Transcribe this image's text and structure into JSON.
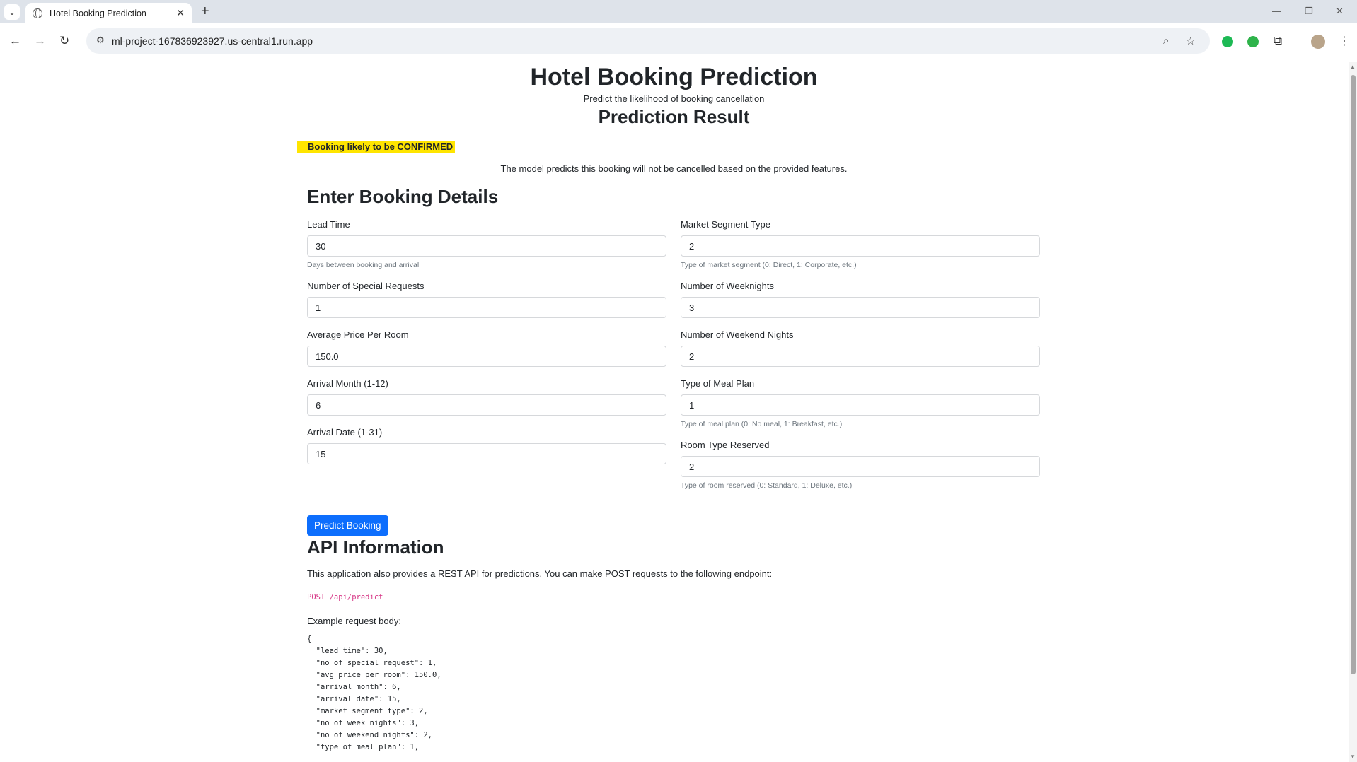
{
  "browser": {
    "tab_title": "Hotel Booking Prediction",
    "url": "ml-project-167836923927.us-central1.run.app"
  },
  "header": {
    "title": "Hotel Booking Prediction",
    "subtitle": "Predict the likelihood of booking cancellation"
  },
  "result": {
    "title": "Prediction Result",
    "badge": "Booking likely to be CONFIRMED",
    "description": "The model predicts this booking will not be cancelled based on the provided features."
  },
  "form": {
    "title": "Enter Booking Details",
    "lead_time": {
      "label": "Lead Time",
      "value": "30",
      "help": "Days between booking and arrival"
    },
    "special_requests": {
      "label": "Number of Special Requests",
      "value": "1"
    },
    "avg_price": {
      "label": "Average Price Per Room",
      "value": "150.0"
    },
    "arrival_month": {
      "label": "Arrival Month (1-12)",
      "value": "6"
    },
    "arrival_date": {
      "label": "Arrival Date (1-31)",
      "value": "15"
    },
    "market_segment": {
      "label": "Market Segment Type",
      "value": "2",
      "help": "Type of market segment (0: Direct, 1: Corporate, etc.)"
    },
    "week_nights": {
      "label": "Number of Weeknights",
      "value": "3"
    },
    "weekend_nights": {
      "label": "Number of Weekend Nights",
      "value": "2"
    },
    "meal_plan": {
      "label": "Type of Meal Plan",
      "value": "1",
      "help": "Type of meal plan (0: No meal, 1: Breakfast, etc.)"
    },
    "room_type": {
      "label": "Room Type Reserved",
      "value": "2",
      "help": "Type of room reserved (0: Standard, 1: Deluxe, etc.)"
    },
    "submit_label": "Predict Booking"
  },
  "api": {
    "title": "API Information",
    "description": "This application also provides a REST API for predictions. You can make POST requests to the following endpoint:",
    "endpoint": "POST /api/predict",
    "example_label": "Example request body:",
    "example_body": "{\n  \"lead_time\": 30,\n  \"no_of_special_request\": 1,\n  \"avg_price_per_room\": 150.0,\n  \"arrival_month\": 6,\n  \"arrival_date\": 15,\n  \"market_segment_type\": 2,\n  \"no_of_week_nights\": 3,\n  \"no_of_weekend_nights\": 2,\n  \"type_of_meal_plan\": 1,"
  }
}
